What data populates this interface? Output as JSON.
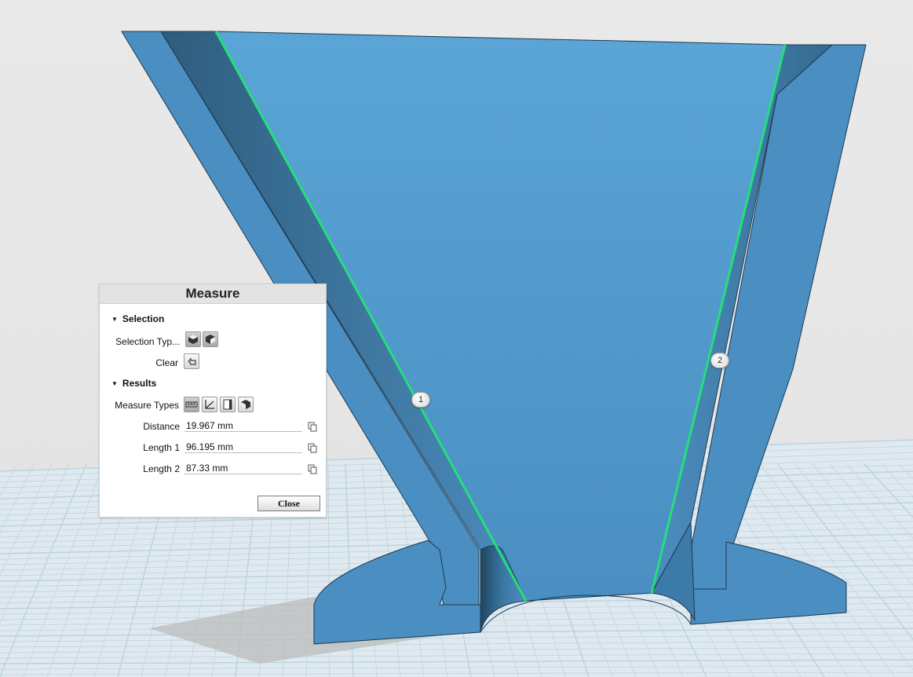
{
  "panel": {
    "title": "Measure",
    "selection_section": "Selection",
    "selection_type_label": "Selection Typ...",
    "clear_label": "Clear",
    "results_section": "Results",
    "measure_types_label": "Measure Types",
    "results": [
      {
        "label": "Distance",
        "value": "19.967 mm"
      },
      {
        "label": "Length 1",
        "value": "96.195 mm"
      },
      {
        "label": "Length 2",
        "value": "87.33 mm"
      }
    ],
    "close_label": "Close"
  },
  "markers": {
    "edge1": "1",
    "edge2": "2"
  },
  "colors": {
    "model_face": "#4e93c6",
    "model_dark": "#2f5f80",
    "highlight_edge": "#22e07a",
    "grid": "#b9d3e1"
  },
  "icons": {
    "selection_types": [
      "solid-select-icon",
      "face-select-icon"
    ],
    "clear": "clear-selection-icon",
    "measure_types": [
      "distance-icon",
      "angle-icon",
      "area-icon",
      "volume-icon"
    ],
    "copy": "copy-icon"
  }
}
